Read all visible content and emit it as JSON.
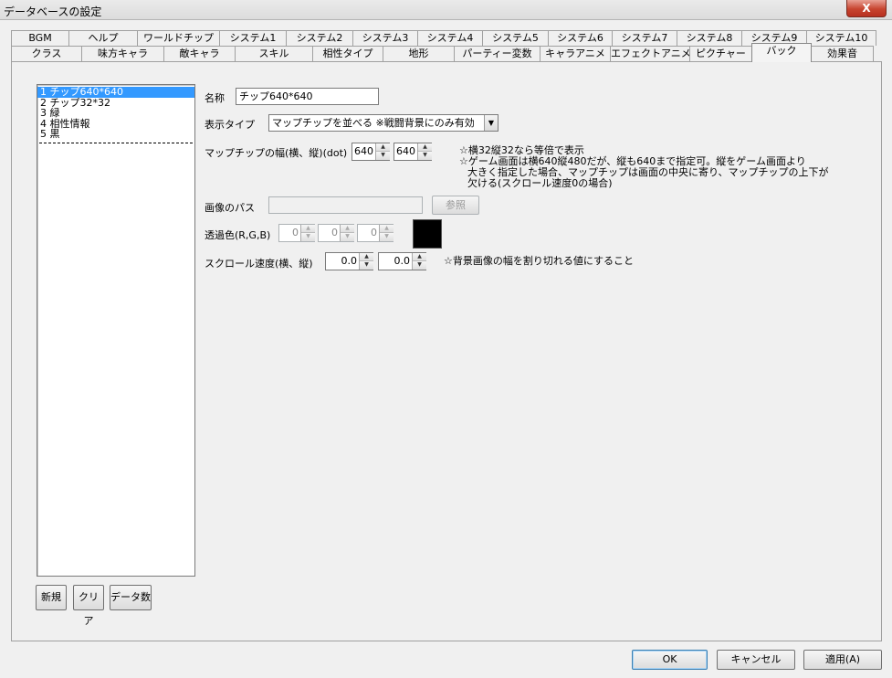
{
  "window": {
    "title": "データベースの設定",
    "close_glyph": "X"
  },
  "tabs_row1": [
    "BGM",
    "ヘルプ",
    "ワールドチップ",
    "システム1",
    "システム2",
    "システム3",
    "システム4",
    "システム5",
    "システム6",
    "システム7",
    "システム8",
    "システム9",
    "システム10"
  ],
  "tabs_row2": [
    "クラス",
    "味方キャラ",
    "敵キャラ",
    "スキル",
    "相性タイプ",
    "地形",
    "パーティー変数",
    "キャラアニメ",
    "エフェクトアニメ",
    "ピクチャー",
    "バック",
    "効果音"
  ],
  "active_tab": "バック",
  "list": {
    "items": [
      "1 チップ640*640",
      "2 チップ32*32",
      "3 緑",
      "4 相性情報",
      "5 黒"
    ],
    "selected_index": 0
  },
  "list_buttons": {
    "new": "新規",
    "clear": "クリア",
    "count": "データ数"
  },
  "form": {
    "name_label": "名称",
    "name_value": "チップ640*640",
    "display_type_label": "表示タイプ",
    "display_type_value": "マップチップを並べる ※戦闘背景にのみ有効",
    "chip_size_label": "マップチップの幅(横、縦)(dot)",
    "chip_w": "640",
    "chip_h": "640",
    "chip_notes": [
      "☆横32縦32なら等倍で表示",
      "☆ゲーム画面は横640縦480だが、縦も640まで指定可。縦をゲーム画面より",
      "大きく指定した場合、マップチップは画面の中央に寄り、マップチップの上下が",
      "欠ける(スクロール速度0の場合)"
    ],
    "image_path_label": "画像のパス",
    "image_path_value": "",
    "browse_label": "参照",
    "transparent_label": "透過色(R,G,B)",
    "trans_r": "0",
    "trans_g": "0",
    "trans_b": "0",
    "scroll_label": "スクロール速度(横、縦)",
    "scroll_x": "0.0",
    "scroll_y": "0.0",
    "scroll_note": "☆背景画像の幅を割り切れる値にすること",
    "color_swatch": "#000000"
  },
  "footer": {
    "ok": "OK",
    "cancel": "キャンセル",
    "apply": "適用(A)"
  },
  "icons": {
    "spin_up": "▲",
    "spin_down": "▼",
    "dropdown": "▼"
  }
}
